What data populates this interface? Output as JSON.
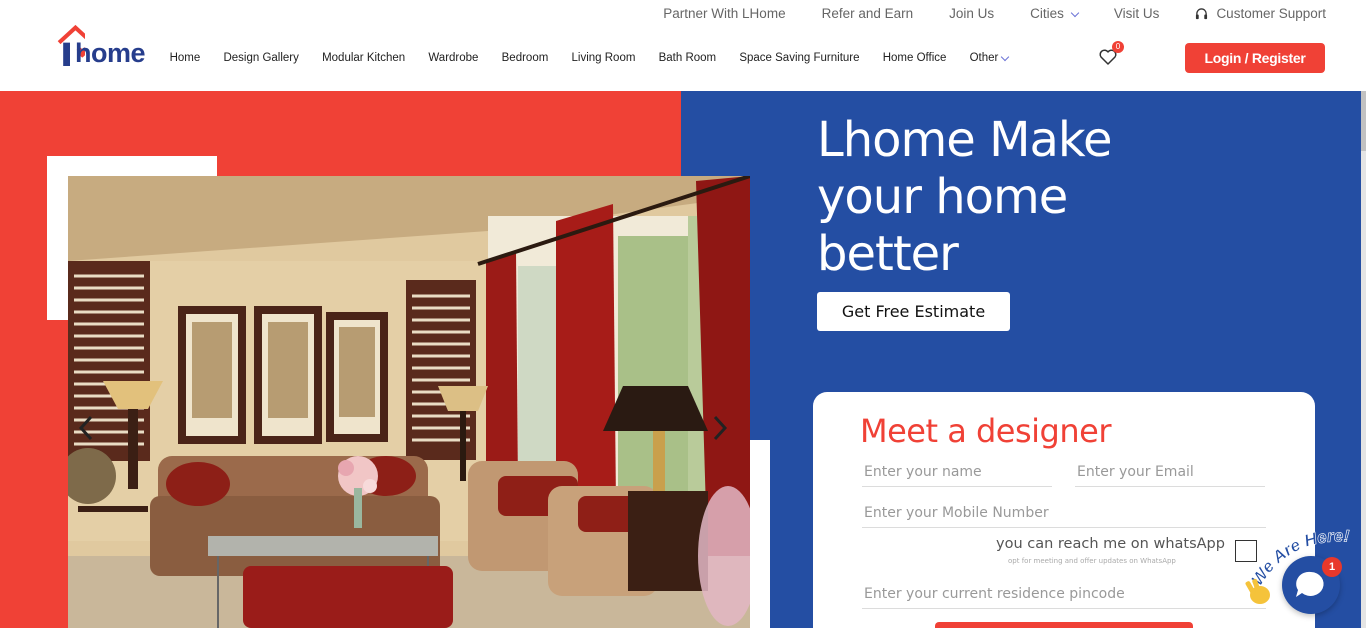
{
  "brand": {
    "logo_text": "home",
    "accent": "#f04136",
    "primary": "#244ea3"
  },
  "top_nav": [
    {
      "label": "Partner With LHome"
    },
    {
      "label": "Refer and Earn"
    },
    {
      "label": "Join Us"
    },
    {
      "label": "Cities",
      "dropdown": true
    },
    {
      "label": "Visit Us"
    },
    {
      "label": "Customer Support",
      "icon": "headset-icon"
    }
  ],
  "main_nav": [
    {
      "label": "Home"
    },
    {
      "label": "Design Gallery"
    },
    {
      "label": "Modular Kitchen"
    },
    {
      "label": "Wardrobe"
    },
    {
      "label": "Bedroom"
    },
    {
      "label": "Living Room"
    },
    {
      "label": "Bath Room"
    },
    {
      "label": "Space Saving Furniture"
    },
    {
      "label": "Home Office"
    },
    {
      "label": "Other",
      "dropdown": true
    }
  ],
  "wishlist": {
    "count": "0",
    "icon": "heart-icon"
  },
  "login_label": "Login / Register",
  "hero": {
    "title_lines": [
      "Lhome Make",
      "your home",
      "better"
    ],
    "cta_label": "Get Free Estimate",
    "image_subject": "living-room-photo"
  },
  "form": {
    "title": "Meet a designer",
    "name_placeholder": "Enter your name",
    "email_placeholder": "Enter your Email",
    "mobile_placeholder": "Enter your Mobile Number",
    "whatsapp_label": "you can reach me on whatsApp",
    "whatsapp_sub": "opt for meeting and offer updates on WhatsApp",
    "pincode_placeholder": "Enter your current residence pincode"
  },
  "chat": {
    "tagline": "We Are Here!",
    "badge": "1"
  }
}
